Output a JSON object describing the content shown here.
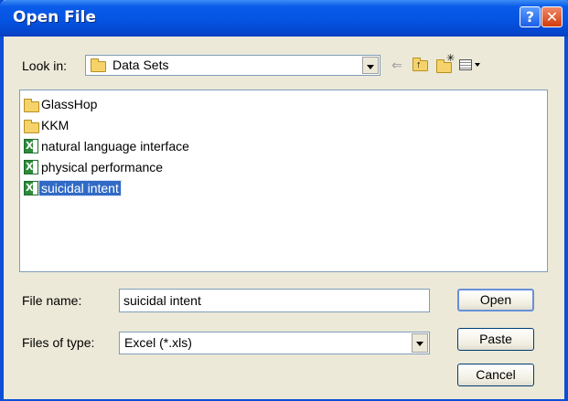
{
  "dialog": {
    "title": "Open File"
  },
  "titlebar": {
    "help_label": "?",
    "close_label": "✕"
  },
  "look_in": {
    "label": "Look in:",
    "value": "Data Sets"
  },
  "toolbar": {
    "icons": [
      "back-arrow-icon",
      "up-folder-icon",
      "new-folder-icon",
      "view-menu-icon"
    ]
  },
  "files": [
    {
      "name": "GlassHop",
      "type": "folder"
    },
    {
      "name": "KKM",
      "type": "folder"
    },
    {
      "name": "natural language interface",
      "type": "excel"
    },
    {
      "name": "physical performance",
      "type": "excel"
    },
    {
      "name": "suicidal intent",
      "type": "excel",
      "selected": true
    }
  ],
  "file_name": {
    "label": "File name:",
    "value": "suicidal intent"
  },
  "file_type": {
    "label": "Files of type:",
    "value": "Excel (*.xls)"
  },
  "buttons": {
    "open": "Open",
    "paste": "Paste",
    "cancel": "Cancel"
  }
}
